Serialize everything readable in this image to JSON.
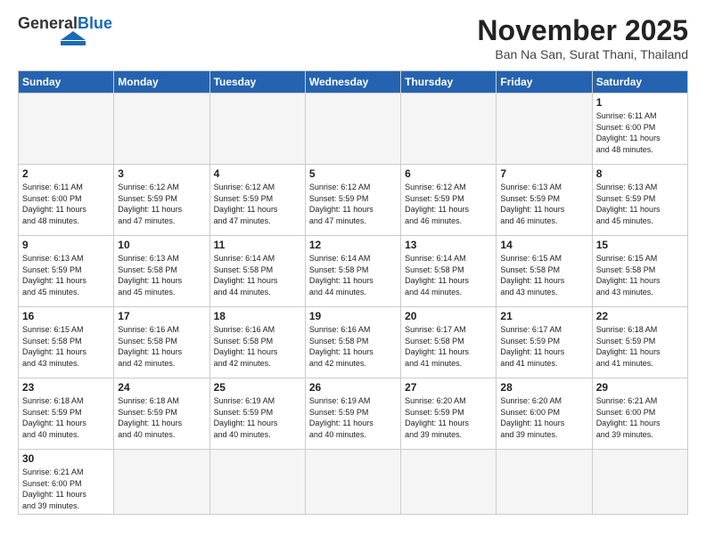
{
  "logo": {
    "text_general": "General",
    "text_blue": "Blue"
  },
  "title": "November 2025",
  "subtitle": "Ban Na San, Surat Thani, Thailand",
  "days_of_week": [
    "Sunday",
    "Monday",
    "Tuesday",
    "Wednesday",
    "Thursday",
    "Friday",
    "Saturday"
  ],
  "weeks": [
    [
      {
        "day": "",
        "info": ""
      },
      {
        "day": "",
        "info": ""
      },
      {
        "day": "",
        "info": ""
      },
      {
        "day": "",
        "info": ""
      },
      {
        "day": "",
        "info": ""
      },
      {
        "day": "",
        "info": ""
      },
      {
        "day": "1",
        "info": "Sunrise: 6:11 AM\nSunset: 6:00 PM\nDaylight: 11 hours\nand 48 minutes."
      }
    ],
    [
      {
        "day": "2",
        "info": "Sunrise: 6:11 AM\nSunset: 6:00 PM\nDaylight: 11 hours\nand 48 minutes."
      },
      {
        "day": "3",
        "info": "Sunrise: 6:12 AM\nSunset: 5:59 PM\nDaylight: 11 hours\nand 47 minutes."
      },
      {
        "day": "4",
        "info": "Sunrise: 6:12 AM\nSunset: 5:59 PM\nDaylight: 11 hours\nand 47 minutes."
      },
      {
        "day": "5",
        "info": "Sunrise: 6:12 AM\nSunset: 5:59 PM\nDaylight: 11 hours\nand 47 minutes."
      },
      {
        "day": "6",
        "info": "Sunrise: 6:12 AM\nSunset: 5:59 PM\nDaylight: 11 hours\nand 46 minutes."
      },
      {
        "day": "7",
        "info": "Sunrise: 6:13 AM\nSunset: 5:59 PM\nDaylight: 11 hours\nand 46 minutes."
      },
      {
        "day": "8",
        "info": "Sunrise: 6:13 AM\nSunset: 5:59 PM\nDaylight: 11 hours\nand 45 minutes."
      }
    ],
    [
      {
        "day": "9",
        "info": "Sunrise: 6:13 AM\nSunset: 5:59 PM\nDaylight: 11 hours\nand 45 minutes."
      },
      {
        "day": "10",
        "info": "Sunrise: 6:13 AM\nSunset: 5:58 PM\nDaylight: 11 hours\nand 45 minutes."
      },
      {
        "day": "11",
        "info": "Sunrise: 6:14 AM\nSunset: 5:58 PM\nDaylight: 11 hours\nand 44 minutes."
      },
      {
        "day": "12",
        "info": "Sunrise: 6:14 AM\nSunset: 5:58 PM\nDaylight: 11 hours\nand 44 minutes."
      },
      {
        "day": "13",
        "info": "Sunrise: 6:14 AM\nSunset: 5:58 PM\nDaylight: 11 hours\nand 44 minutes."
      },
      {
        "day": "14",
        "info": "Sunrise: 6:15 AM\nSunset: 5:58 PM\nDaylight: 11 hours\nand 43 minutes."
      },
      {
        "day": "15",
        "info": "Sunrise: 6:15 AM\nSunset: 5:58 PM\nDaylight: 11 hours\nand 43 minutes."
      }
    ],
    [
      {
        "day": "16",
        "info": "Sunrise: 6:15 AM\nSunset: 5:58 PM\nDaylight: 11 hours\nand 43 minutes."
      },
      {
        "day": "17",
        "info": "Sunrise: 6:16 AM\nSunset: 5:58 PM\nDaylight: 11 hours\nand 42 minutes."
      },
      {
        "day": "18",
        "info": "Sunrise: 6:16 AM\nSunset: 5:58 PM\nDaylight: 11 hours\nand 42 minutes."
      },
      {
        "day": "19",
        "info": "Sunrise: 6:16 AM\nSunset: 5:58 PM\nDaylight: 11 hours\nand 42 minutes."
      },
      {
        "day": "20",
        "info": "Sunrise: 6:17 AM\nSunset: 5:58 PM\nDaylight: 11 hours\nand 41 minutes."
      },
      {
        "day": "21",
        "info": "Sunrise: 6:17 AM\nSunset: 5:59 PM\nDaylight: 11 hours\nand 41 minutes."
      },
      {
        "day": "22",
        "info": "Sunrise: 6:18 AM\nSunset: 5:59 PM\nDaylight: 11 hours\nand 41 minutes."
      }
    ],
    [
      {
        "day": "23",
        "info": "Sunrise: 6:18 AM\nSunset: 5:59 PM\nDaylight: 11 hours\nand 40 minutes."
      },
      {
        "day": "24",
        "info": "Sunrise: 6:18 AM\nSunset: 5:59 PM\nDaylight: 11 hours\nand 40 minutes."
      },
      {
        "day": "25",
        "info": "Sunrise: 6:19 AM\nSunset: 5:59 PM\nDaylight: 11 hours\nand 40 minutes."
      },
      {
        "day": "26",
        "info": "Sunrise: 6:19 AM\nSunset: 5:59 PM\nDaylight: 11 hours\nand 40 minutes."
      },
      {
        "day": "27",
        "info": "Sunrise: 6:20 AM\nSunset: 5:59 PM\nDaylight: 11 hours\nand 39 minutes."
      },
      {
        "day": "28",
        "info": "Sunrise: 6:20 AM\nSunset: 6:00 PM\nDaylight: 11 hours\nand 39 minutes."
      },
      {
        "day": "29",
        "info": "Sunrise: 6:21 AM\nSunset: 6:00 PM\nDaylight: 11 hours\nand 39 minutes."
      }
    ],
    [
      {
        "day": "30",
        "info": "Sunrise: 6:21 AM\nSunset: 6:00 PM\nDaylight: 11 hours\nand 39 minutes."
      },
      {
        "day": "",
        "info": ""
      },
      {
        "day": "",
        "info": ""
      },
      {
        "day": "",
        "info": ""
      },
      {
        "day": "",
        "info": ""
      },
      {
        "day": "",
        "info": ""
      },
      {
        "day": "",
        "info": ""
      }
    ]
  ]
}
